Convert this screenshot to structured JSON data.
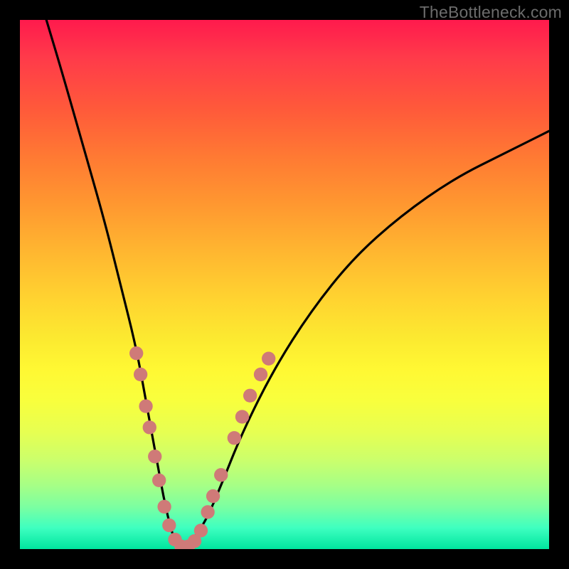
{
  "watermark_text": "TheBottleneck.com",
  "chart_data": {
    "type": "line",
    "title": "",
    "xlabel": "",
    "ylabel": "",
    "xlim": [
      0,
      100
    ],
    "ylim": [
      0,
      100
    ],
    "grid": false,
    "legend": false,
    "background_gradient": [
      "#ff1a4d",
      "#ffd430",
      "#00e59e"
    ],
    "series": [
      {
        "name": "bottleneck-curve",
        "color": "#000000",
        "x": [
          5,
          8,
          12,
          16,
          19,
          22,
          24,
          26,
          27.5,
          29,
          30.5,
          32,
          35,
          38,
          42,
          48,
          55,
          63,
          72,
          82,
          92,
          100
        ],
        "values": [
          100,
          90,
          76,
          62,
          50,
          38,
          27,
          16,
          8,
          2,
          0,
          1,
          5,
          12,
          22,
          34,
          45,
          55,
          63,
          70,
          75,
          79
        ]
      }
    ],
    "markers": [
      {
        "name": "left-branch-dots",
        "color": "#cf7a78",
        "radius_pct": 1.3,
        "points": [
          {
            "x": 22.0,
            "y": 37
          },
          {
            "x": 22.8,
            "y": 33
          },
          {
            "x": 23.8,
            "y": 27
          },
          {
            "x": 24.5,
            "y": 23
          },
          {
            "x": 25.5,
            "y": 17.5
          },
          {
            "x": 26.3,
            "y": 13
          },
          {
            "x": 27.3,
            "y": 8
          },
          {
            "x": 28.2,
            "y": 4.5
          },
          {
            "x": 29.3,
            "y": 1.8
          },
          {
            "x": 30.5,
            "y": 0.5
          },
          {
            "x": 31.8,
            "y": 0.5
          },
          {
            "x": 33.0,
            "y": 1.5
          }
        ]
      },
      {
        "name": "right-branch-dots",
        "color": "#cf7a78",
        "radius_pct": 1.3,
        "points": [
          {
            "x": 34.2,
            "y": 3.5
          },
          {
            "x": 35.5,
            "y": 7
          },
          {
            "x": 36.5,
            "y": 10
          },
          {
            "x": 38.0,
            "y": 14
          },
          {
            "x": 40.5,
            "y": 21
          },
          {
            "x": 42.0,
            "y": 25
          },
          {
            "x": 43.5,
            "y": 29
          },
          {
            "x": 45.5,
            "y": 33
          },
          {
            "x": 47.0,
            "y": 36
          }
        ]
      }
    ]
  }
}
